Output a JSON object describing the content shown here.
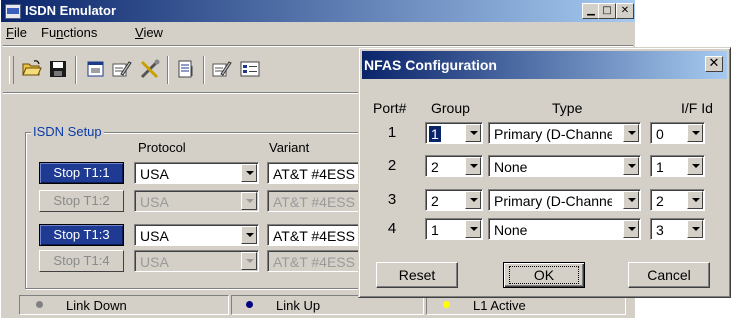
{
  "main_window": {
    "title": "ISDN Emulator",
    "menus": [
      {
        "label": "File",
        "accel": "F",
        "rest": "ile"
      },
      {
        "label": "Functions",
        "pre": "Fu",
        "accel": "n",
        "rest": "ctions"
      },
      {
        "label": "View",
        "accel": "V",
        "rest": "iew"
      }
    ],
    "toolbar_icons": [
      "open-folder-icon",
      "save-icon",
      "window-icon",
      "edit-card-icon",
      "tools-icon",
      "page-icon",
      "card-icon",
      "list-icon"
    ],
    "isdn_setup": {
      "label": "ISDN Setup",
      "protocol_header": "Protocol",
      "variant_header": "Variant",
      "rows": [
        {
          "button": "Stop T1:1",
          "state": "active",
          "protocol": "USA",
          "variant": "AT&T #4ESS"
        },
        {
          "button": "Stop T1:2",
          "state": "disabled",
          "protocol": "USA",
          "variant": "AT&T #4ESS"
        },
        {
          "button": "Stop T1:3",
          "state": "active",
          "protocol": "USA",
          "variant": "AT&T #4ESS"
        },
        {
          "button": "Stop T1:4",
          "state": "disabled",
          "protocol": "USA",
          "variant": "AT&T #4ESS"
        }
      ]
    },
    "status_bar": [
      {
        "text": "Link Down",
        "dot_color": "#808080"
      },
      {
        "text": "Link Up",
        "dot_color": "#000080"
      },
      {
        "text": "L1 Active",
        "dot_color": "#ffff00"
      }
    ]
  },
  "nfas_dialog": {
    "title": "NFAS Configuration",
    "headers": {
      "port": "Port#",
      "group": "Group",
      "type": "Type",
      "if_id": "I/F Id"
    },
    "rows": [
      {
        "port": "1",
        "group": "1",
        "type": "Primary (D-Channel)",
        "if_id": "0"
      },
      {
        "port": "2",
        "group": "2",
        "type": "None",
        "if_id": "1"
      },
      {
        "port": "3",
        "group": "2",
        "type": "Primary (D-Channel)",
        "if_id": "2"
      },
      {
        "port": "4",
        "group": "1",
        "type": "None",
        "if_id": "3"
      }
    ],
    "buttons": {
      "reset": "Reset",
      "ok": "OK",
      "cancel": "Cancel"
    },
    "focused_field": "group-row-1"
  }
}
